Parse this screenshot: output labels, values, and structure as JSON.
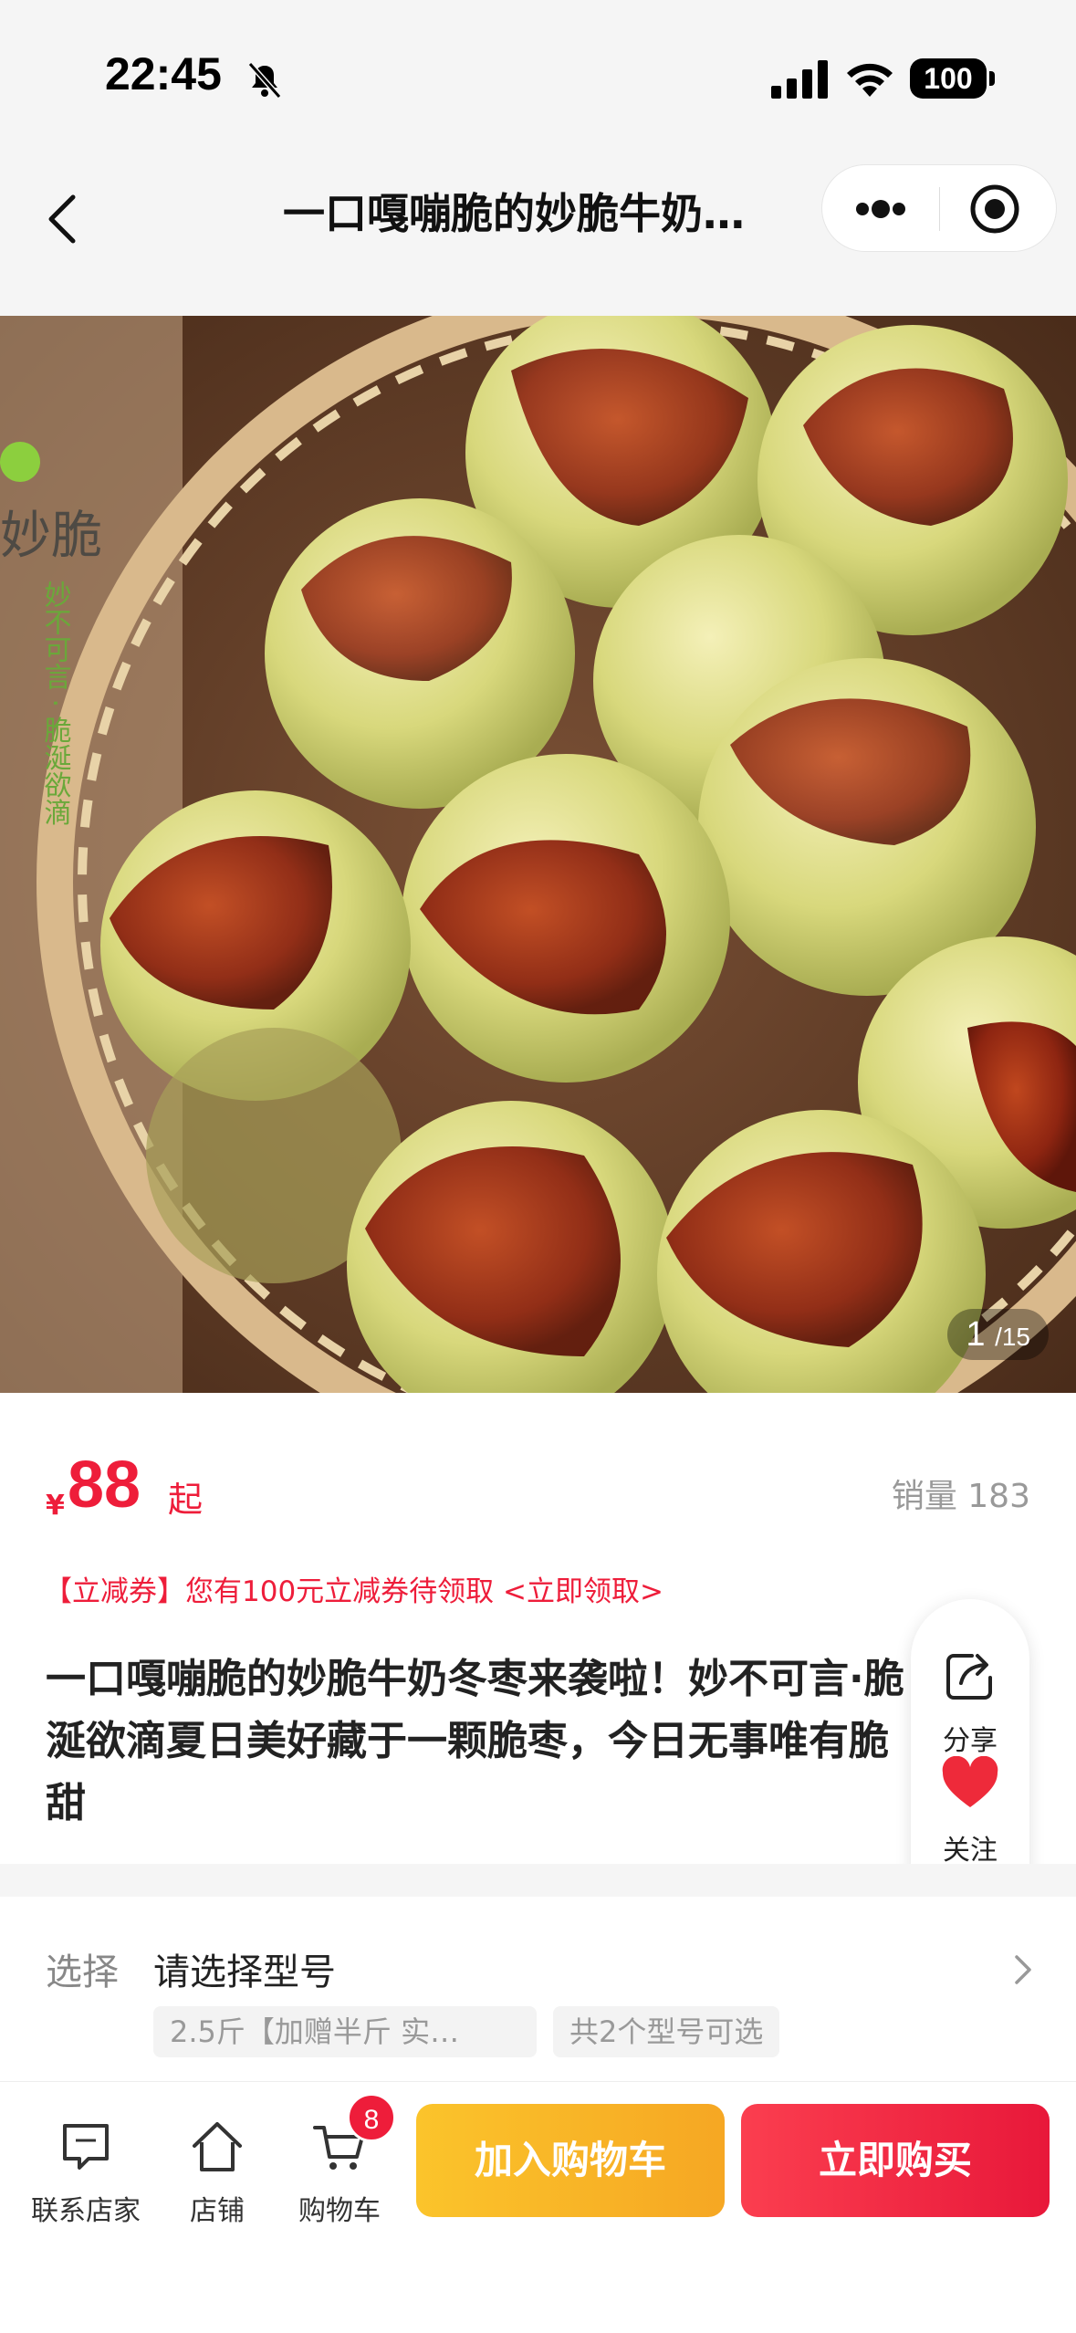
{
  "status_bar": {
    "time": "22:45",
    "battery": "100"
  },
  "nav": {
    "title": "一口嘎嘣脆的妙脆牛奶…"
  },
  "gallery": {
    "current": "1",
    "total": "/15",
    "watermark_brand": "妙脆",
    "watermark_slogan": "妙不可言 · 脆涎欲滴"
  },
  "product": {
    "currency": "¥",
    "price": "88",
    "price_suffix": "起",
    "sales": "销量 183",
    "coupon": "【立减券】您有100元立减券待领取 <立即领取>",
    "title": "一口嘎嘣脆的妙脆牛奶冬枣来袭啦！妙不可言·脆涎欲滴夏日美好藏于一颗脆枣，今日无事唯有脆甜"
  },
  "float_actions": {
    "share": "分享",
    "follow": "关注"
  },
  "variant": {
    "label": "选择",
    "value": "请选择型号",
    "tags": [
      "2.5斤【加赠半斤 实…",
      "共2个型号可选"
    ]
  },
  "bottom_bar": {
    "contact": "联系店家",
    "store": "店铺",
    "cart": "购物车",
    "cart_count": "8",
    "add_to_cart": "加入购物车",
    "buy_now": "立即购买"
  },
  "colors": {
    "accent_red": "#ee1d3a",
    "accent_yellow": "#fbc42b"
  }
}
